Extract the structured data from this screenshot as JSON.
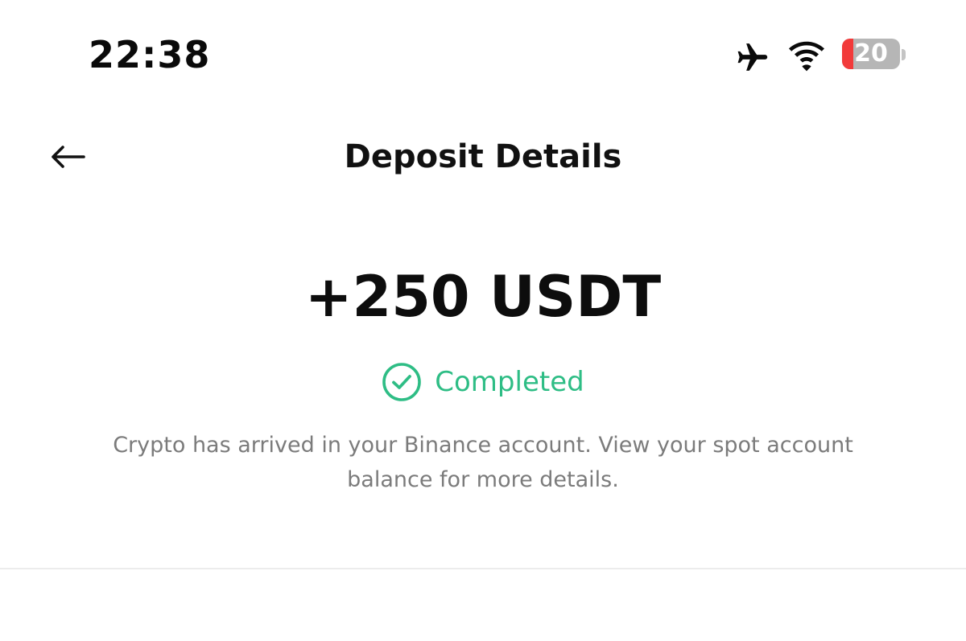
{
  "status_bar": {
    "time": "22:38",
    "battery_level": "20",
    "battery_fraction": 0.2,
    "icons": [
      "airplane-mode-icon",
      "wifi-icon",
      "battery-icon"
    ]
  },
  "header": {
    "title": "Deposit Details",
    "back_icon": "arrow-left-icon"
  },
  "deposit": {
    "amount": "+250 USDT",
    "status": "Completed",
    "status_icon": "check-circle-icon",
    "description": "Crypto has arrived in your Binance account. View your spot account balance for more details."
  },
  "colors": {
    "status_green": "#2ebd85",
    "battery_low": "#f23a3a",
    "text_primary": "#111111",
    "text_secondary": "#7b7b7b"
  }
}
